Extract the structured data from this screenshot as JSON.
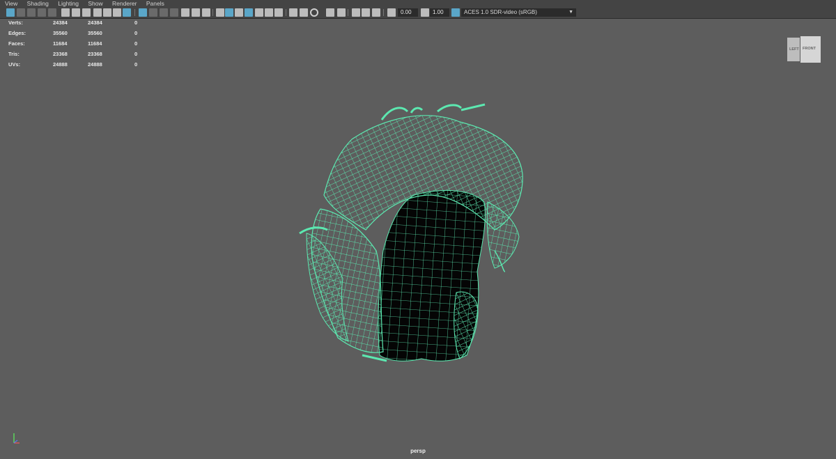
{
  "menu": [
    "View",
    "Shading",
    "Lighting",
    "Show",
    "Renderer",
    "Panels"
  ],
  "toolbar": {
    "gamma_value": "0.00",
    "exposure_value": "1.00",
    "colorspace": "ACES 1.0 SDR-video (sRGB)"
  },
  "hud": {
    "rows": [
      {
        "label": "Verts:",
        "v1": "24384",
        "v2": "24384",
        "v3": "0"
      },
      {
        "label": "Edges:",
        "v1": "35560",
        "v2": "35560",
        "v3": "0"
      },
      {
        "label": "Faces:",
        "v1": "11684",
        "v2": "11684",
        "v3": "0"
      },
      {
        "label": "Tris:",
        "v1": "23368",
        "v2": "23368",
        "v3": "0"
      },
      {
        "label": "UVs:",
        "v1": "24888",
        "v2": "24888",
        "v3": "0"
      }
    ]
  },
  "viewcube": {
    "left_face": "LEFT",
    "front_face": "FRONT"
  },
  "camera_name": "persp",
  "colors": {
    "viewport_bg": "#5d5d5d",
    "wireframe": "#5ce8b0",
    "scalp": "#000000",
    "accent": "#5aa6c8"
  }
}
